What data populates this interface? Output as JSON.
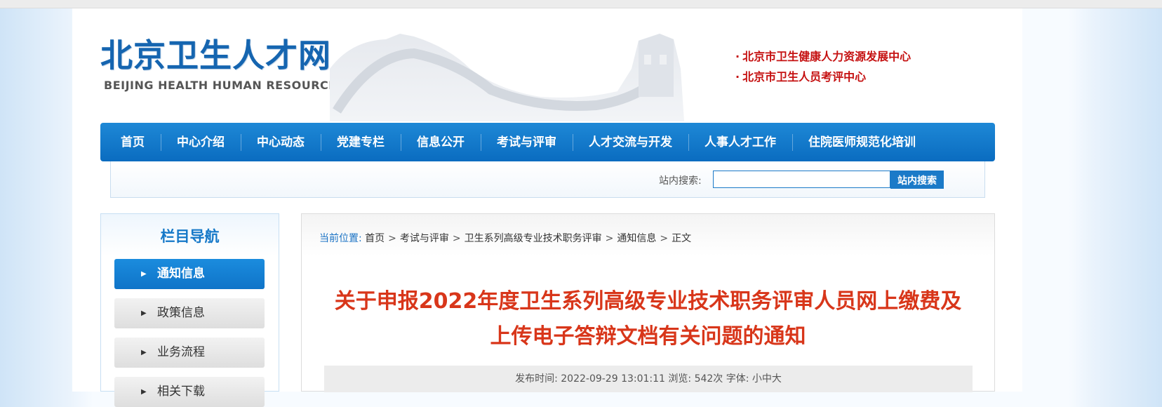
{
  "header": {
    "logo_cn": "北京卫生人才网",
    "logo_en": "BEIJING HEALTH HUMAN RESOURCE",
    "org_links": [
      "北京市卫生健康人力资源发展中心",
      "北京市卫生人员考评中心"
    ]
  },
  "nav": {
    "items": [
      "首页",
      "中心介绍",
      "中心动态",
      "党建专栏",
      "信息公开",
      "考试与评审",
      "人才交流与开发",
      "人事人才工作",
      "住院医师规范化培训"
    ]
  },
  "search": {
    "label": "站内搜索:",
    "value": "",
    "button": "站内搜索"
  },
  "sidebar": {
    "title": "栏目导航",
    "items": [
      {
        "label": "通知信息",
        "active": true
      },
      {
        "label": "政策信息",
        "active": false
      },
      {
        "label": "业务流程",
        "active": false
      },
      {
        "label": "相关下载",
        "active": false
      }
    ]
  },
  "breadcrumb": {
    "prefix": "当前位置:",
    "items": [
      "首页",
      "考试与评审",
      "卫生系列高级专业技术职务评审",
      "通知信息",
      "正文"
    ],
    "separator": ">"
  },
  "article": {
    "title_line1": "关于申报2022年度卫生系列高级专业技术职务评审人员网上缴费及",
    "title_line2": "上传电子答辩文档有关问题的通知",
    "meta": "发布时间: 2022-09-29 13:01:11 浏览: 542次 字体: 小中大"
  },
  "colors": {
    "nav_bg": "#0f74c8",
    "title_red": "#d8361a",
    "org_red": "#c51111",
    "logo_blue": "#1565b0"
  }
}
